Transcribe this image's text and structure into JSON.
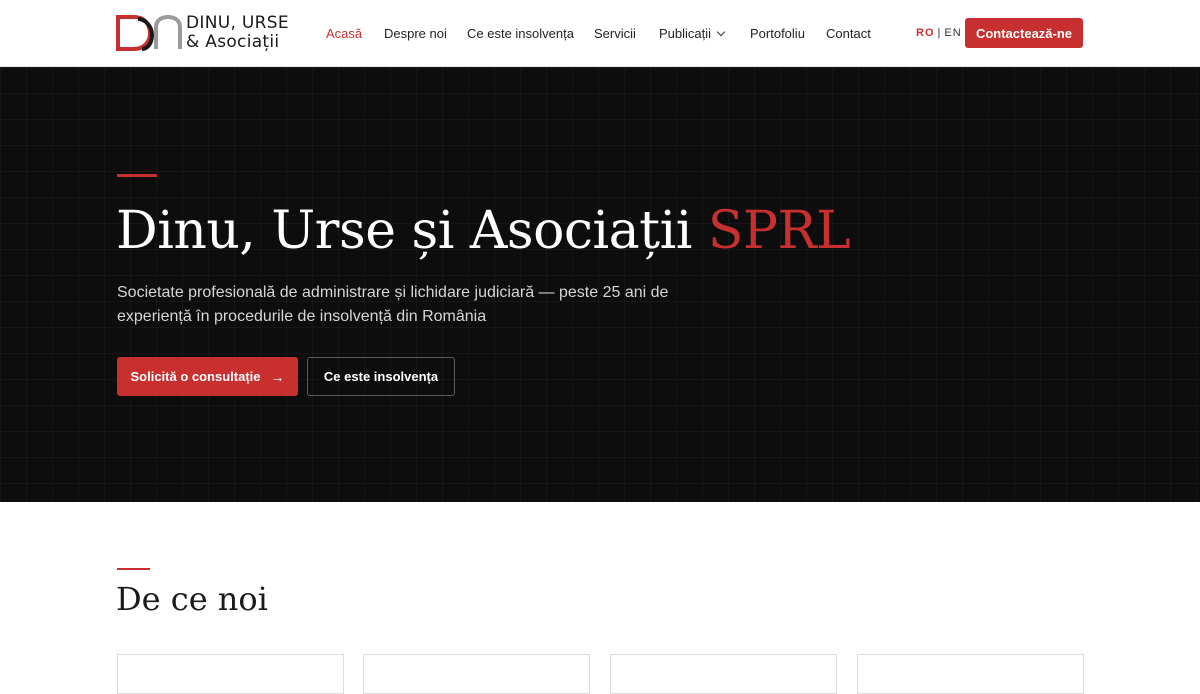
{
  "logo": {
    "line1": "DINU, URSE",
    "line2": "& Asociații"
  },
  "nav": {
    "items": [
      {
        "label": "Acasă"
      },
      {
        "label": "Despre noi"
      },
      {
        "label": "Ce este insolvența"
      },
      {
        "label": "Servicii"
      },
      {
        "label": "Publicații"
      },
      {
        "label": "Portofoliu"
      },
      {
        "label": "Contact"
      }
    ],
    "lang_ro": "RO",
    "lang_sep": "|",
    "lang_en": "EN",
    "cta": "Contactează-ne"
  },
  "hero": {
    "title_main": "Dinu, Urse și Asociații",
    "title_accent": "SPRL",
    "subtitle": "Societate profesională de administrare și lichidare judiciară — peste 25 ani de experiență în procedurile de insolvență din România",
    "primary_button": "Solicită o consultație",
    "secondary_button": "Ce este insolvența"
  },
  "section": {
    "title": "De ce noi"
  },
  "colors": {
    "accent": "#c8302f",
    "hero_bg": "#0d0d0d"
  }
}
